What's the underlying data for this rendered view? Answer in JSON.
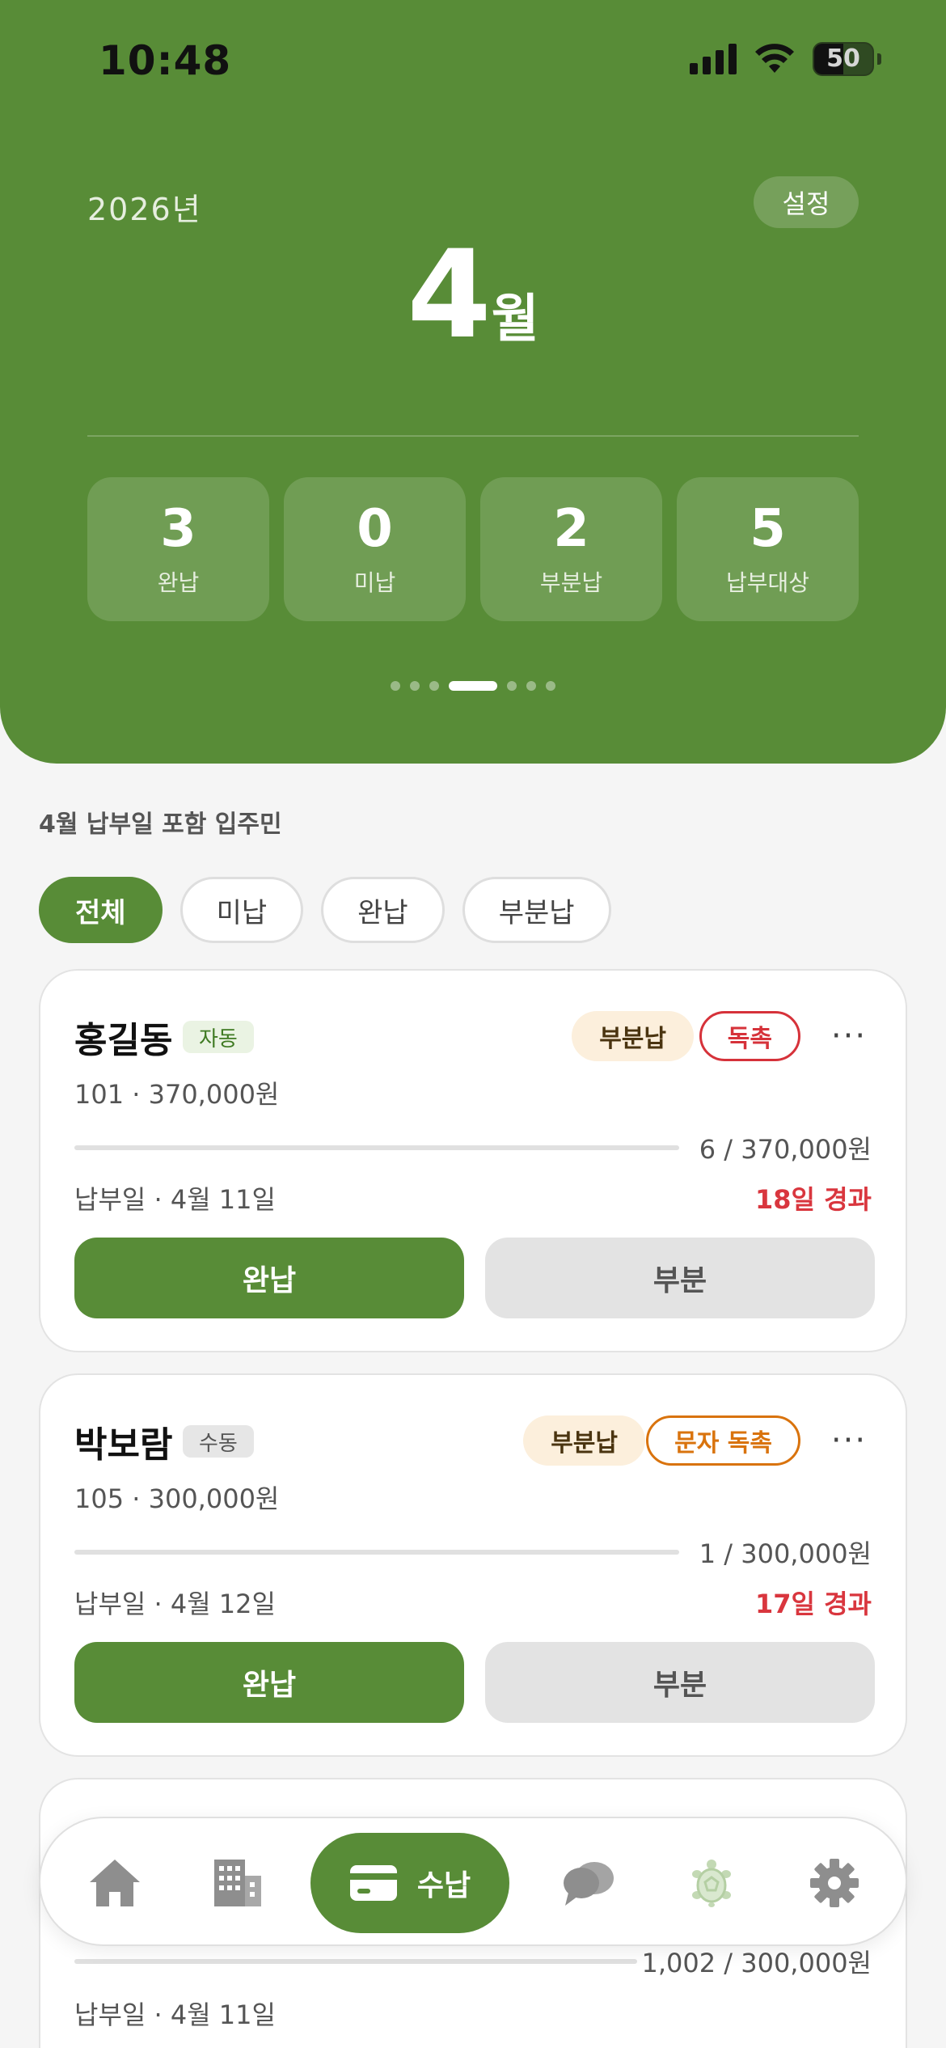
{
  "status_bar": {
    "time": "10:48",
    "battery": "50"
  },
  "header": {
    "year": "2026년",
    "settings_label": "설정",
    "month_num": "4",
    "month_unit": "월",
    "stats": [
      {
        "value": "3",
        "label": "완납"
      },
      {
        "value": "0",
        "label": "미납"
      },
      {
        "value": "2",
        "label": "부분납"
      },
      {
        "value": "5",
        "label": "납부대상"
      }
    ],
    "pager": {
      "count": 7,
      "active_index": 3
    }
  },
  "section_title": "4월 납부일 포함 입주민",
  "filters": [
    {
      "label": "전체",
      "active": true
    },
    {
      "label": "미납",
      "active": false
    },
    {
      "label": "완납",
      "active": false
    },
    {
      "label": "부분납",
      "active": false
    }
  ],
  "cards": [
    {
      "name": "홍길동",
      "tag": "자동",
      "status": "부분납",
      "action": "독촉",
      "sub": "101 · 370,000원",
      "amount": "6 / 370,000원",
      "progress": 0.0,
      "due": "납부일 · 4월 11일",
      "overdue": "18일 경과",
      "full_label": "완납",
      "partial_label": "부분"
    },
    {
      "name": "박보람",
      "tag": "수동",
      "status": "부분납",
      "action": "문자 독촉",
      "sub": "105 · 300,000원",
      "amount": "1 / 300,000원",
      "progress": 0.0,
      "due": "납부일 · 4월 12일",
      "overdue": "17일 경과",
      "full_label": "완납",
      "partial_label": "부분"
    },
    {
      "amount": "1,002 / 300,000원",
      "progress": 0.0,
      "due": "납부일 · 4월 11일"
    }
  ],
  "nav": {
    "active_label": "수납"
  },
  "colors": {
    "brand": "#588c37",
    "danger": "#d9363e",
    "warning": "#d9730d"
  },
  "icons": [
    "home-icon",
    "building-icon",
    "card-icon",
    "chat-icon",
    "turtle-icon",
    "gear-icon"
  ]
}
